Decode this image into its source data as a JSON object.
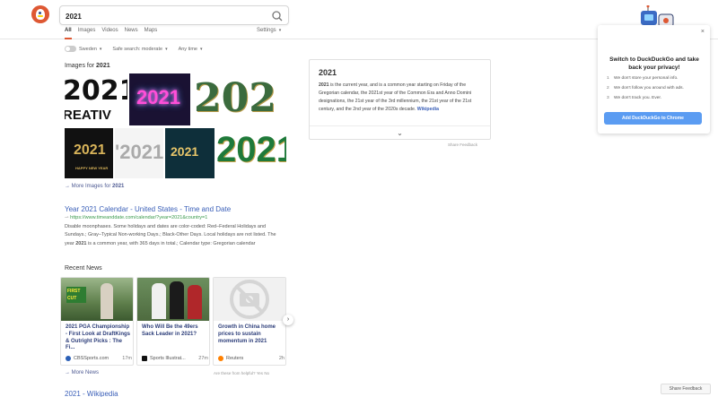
{
  "search": {
    "value": "2021"
  },
  "tabs": [
    {
      "label": "All",
      "active": true
    },
    {
      "label": "Images",
      "active": false
    },
    {
      "label": "Videos",
      "active": false
    },
    {
      "label": "News",
      "active": false
    },
    {
      "label": "Maps",
      "active": false
    }
  ],
  "settings_label": "Settings",
  "filters": {
    "region": "Sweden",
    "safe_search": "Safe search: moderate",
    "time": "Any time"
  },
  "images": {
    "title_prefix": "Images for",
    "title_query": "2021",
    "tiles": [
      {
        "text": "2021"
      },
      {
        "text": "2021"
      },
      {
        "text": "202"
      },
      {
        "text": "2021"
      },
      {
        "text": "'2021"
      },
      {
        "text": "2021"
      },
      {
        "text": "2021"
      }
    ],
    "tile_text_extra": "REATIV",
    "tile_caption": "HAPPY NEW YEAR",
    "more_prefix": "More Images for",
    "more_query": "2021"
  },
  "result": {
    "title": "Year 2021 Calendar - United States - Time and Date",
    "url": "https://www.timeanddate.com/calendar/?year=2021&country=1",
    "snippet_a": "Disable moonphases. Some holidays and dates are color-coded: Red–Federal Holidays and Sundays.; Gray–Typical Non-working Days.; Black-Other Days. Local holidays are not listed. The year ",
    "snippet_bold": "2021",
    "snippet_b": " is a common year, with 365 days in total.; Calendar type: Gregorian calendar"
  },
  "news": {
    "heading": "Recent News",
    "cards": [
      {
        "title": "2021 PGA Championship - First Look at DraftKings & Outright Picks : The Fi...",
        "source": "CBSSports.com",
        "age": "17m",
        "img_text": "FIRST CUT"
      },
      {
        "title": "Who Will Be the 49ers Sack Leader in 2021?",
        "source": "Sports Illustrat...",
        "age": "27m",
        "img_text": ""
      },
      {
        "title": "Growth in China home prices to sustain momentum in 2021",
        "source": "Reuters",
        "age": "2h",
        "img_text": ""
      }
    ],
    "more_label": "More News",
    "feedback_question": "Are these from helpful?",
    "feedback_yes": "Yes",
    "feedback_no": "No"
  },
  "knowledge": {
    "title": "2021",
    "text_bold": "2021",
    "text": " is the current year, and is a common year starting on Friday of the Gregorian calendar, the 2021st year of the Common Era and Anno Domini designations, the 21st year of the 3rd millennium, the 21st year of the 21st century, and the 2nd year of the 2020s decade. ",
    "source": "Wikipedia",
    "share_feedback": "Share Feedback"
  },
  "promo": {
    "title": "Switch to DuckDuckGo and take back your privacy!",
    "items": [
      {
        "n": "1",
        "text": "We don't store your personal info."
      },
      {
        "n": "2",
        "text": "We don't follow you around with ads."
      },
      {
        "n": "3",
        "text": "We don't track you. Ever."
      }
    ],
    "button": "Add DuckDuckGo to Chrome"
  },
  "next_result_title": "2021 - Wikipedia",
  "share_feedback": "Share Feedback",
  "colors": {
    "accent": "#de5833",
    "link": "#3a5fb8",
    "url": "#3a9a4c",
    "button": "#5b9cf2"
  }
}
